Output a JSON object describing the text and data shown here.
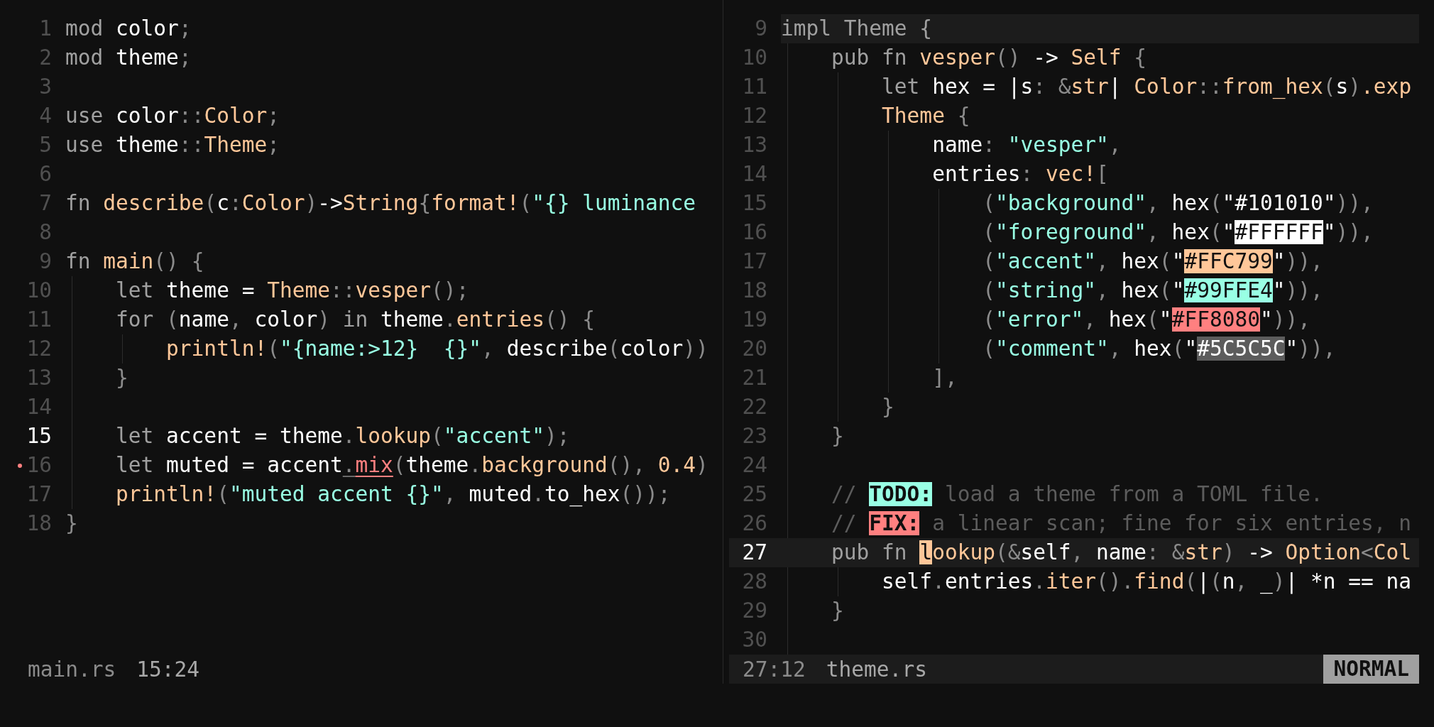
{
  "panes": [
    {
      "active": false,
      "lines": [
        {
          "number": "1",
          "current": false,
          "tokens": [
            {
              "text": "mod",
              "kind": "keyword"
            },
            {
              "text": " color",
              "kind": "ident"
            },
            {
              "text": ";",
              "kind": "punct"
            }
          ]
        },
        {
          "number": "2",
          "current": false,
          "tokens": [
            {
              "text": "mod",
              "kind": "keyword"
            },
            {
              "text": " theme",
              "kind": "ident"
            },
            {
              "text": ";",
              "kind": "punct"
            }
          ]
        },
        {
          "number": "3",
          "current": false
        },
        {
          "number": "4",
          "current": false,
          "tokens": [
            {
              "text": "use",
              "kind": "keyword"
            },
            {
              "text": " color",
              "kind": "ident"
            },
            {
              "text": "::",
              "kind": "punct"
            },
            {
              "text": "Color",
              "kind": "func"
            },
            {
              "text": ";",
              "kind": "punct"
            }
          ]
        },
        {
          "number": "5",
          "current": false,
          "tokens": [
            {
              "text": "use",
              "kind": "keyword"
            },
            {
              "text": " theme",
              "kind": "ident"
            },
            {
              "text": "::",
              "kind": "punct"
            },
            {
              "text": "Theme",
              "kind": "func"
            },
            {
              "text": ";",
              "kind": "punct"
            }
          ]
        },
        {
          "number": "6",
          "current": false
        },
        {
          "number": "7",
          "current": false,
          "tokens": [
            {
              "text": "fn",
              "kind": "keyword"
            },
            {
              "text": " describe",
              "kind": "func"
            },
            {
              "text": "(",
              "kind": "punct"
            },
            {
              "text": "c",
              "kind": "ident"
            },
            {
              "text": ":",
              "kind": "punct"
            },
            {
              "text": "Color",
              "kind": "func"
            },
            {
              "text": ")",
              "kind": "punct"
            },
            {
              "text": "->",
              "kind": "ident"
            },
            {
              "text": "String",
              "kind": "func"
            },
            {
              "text": "{",
              "kind": "punct"
            },
            {
              "text": "format!",
              "kind": "func"
            },
            {
              "text": "(",
              "kind": "punct"
            },
            {
              "text": "\"{} luminance",
              "kind": "string"
            }
          ]
        },
        {
          "number": "8",
          "current": false
        },
        {
          "number": "9",
          "current": false,
          "tokens": [
            {
              "text": "fn",
              "kind": "keyword"
            },
            {
              "text": " main",
              "kind": "func"
            },
            {
              "text": "() {",
              "kind": "punct"
            }
          ]
        },
        {
          "number": "10",
          "current": false,
          "tokens": [
            {
              "text": "    let",
              "kind": "keyword"
            },
            {
              "text": " theme = ",
              "kind": "ident"
            },
            {
              "text": "Theme",
              "kind": "func"
            },
            {
              "text": "::",
              "kind": "punct"
            },
            {
              "text": "vesper",
              "kind": "func"
            },
            {
              "text": "();",
              "kind": "punct"
            }
          ]
        },
        {
          "number": "11",
          "current": false,
          "tokens": [
            {
              "text": "    for",
              "kind": "keyword"
            },
            {
              "text": " (",
              "kind": "punct"
            },
            {
              "text": "name",
              "kind": "ident"
            },
            {
              "text": ", ",
              "kind": "punct"
            },
            {
              "text": "color",
              "kind": "ident"
            },
            {
              "text": ")",
              "kind": "punct"
            },
            {
              "text": " in",
              "kind": "keyword"
            },
            {
              "text": " theme",
              "kind": "ident"
            },
            {
              "text": ".",
              "kind": "punct"
            },
            {
              "text": "entries",
              "kind": "func"
            },
            {
              "text": "() {",
              "kind": "punct"
            }
          ]
        },
        {
          "number": "12",
          "current": false,
          "tokens": [
            {
              "text": "        println!",
              "kind": "func"
            },
            {
              "text": "(",
              "kind": "punct"
            },
            {
              "text": "\"{name:>12}  {}\"",
              "kind": "string"
            },
            {
              "text": ", ",
              "kind": "punct"
            },
            {
              "text": "describe",
              "kind": "ident"
            },
            {
              "text": "(",
              "kind": "punct"
            },
            {
              "text": "color",
              "kind": "ident"
            },
            {
              "text": "))",
              "kind": "punct"
            }
          ]
        },
        {
          "number": "13",
          "current": false,
          "tokens": [
            {
              "text": "    }",
              "kind": "punct"
            }
          ]
        },
        {
          "number": "14",
          "current": false
        },
        {
          "number": "15",
          "current": true,
          "tokens": [
            {
              "text": "    let",
              "kind": "keyword"
            },
            {
              "text": " accent = theme",
              "kind": "ident"
            },
            {
              "text": ".",
              "kind": "punct"
            },
            {
              "text": "lookup",
              "kind": "func"
            },
            {
              "text": "(",
              "kind": "punct"
            },
            {
              "text": "\"accent\"",
              "kind": "string"
            },
            {
              "text": ");",
              "kind": "punct"
            }
          ]
        },
        {
          "number": "16",
          "current": false,
          "has_error": true,
          "tokens": [
            {
              "text": "    let",
              "kind": "keyword"
            },
            {
              "text": " muted = accent",
              "kind": "ident"
            },
            {
              "text": ".",
              "kind": "punct",
              "underlined": true
            },
            {
              "text": "mix",
              "kind": "func",
              "error": true
            },
            {
              "text": "(",
              "kind": "punct"
            },
            {
              "text": "theme",
              "kind": "ident"
            },
            {
              "text": ".",
              "kind": "punct"
            },
            {
              "text": "background",
              "kind": "func"
            },
            {
              "text": "(), ",
              "kind": "punct"
            },
            {
              "text": "0.4",
              "kind": "func"
            },
            {
              "text": ")",
              "kind": "punct"
            }
          ]
        },
        {
          "number": "17",
          "current": false,
          "tokens": [
            {
              "text": "    println!",
              "kind": "func"
            },
            {
              "text": "(",
              "kind": "punct"
            },
            {
              "text": "\"muted accent {}\"",
              "kind": "string"
            },
            {
              "text": ", ",
              "kind": "punct"
            },
            {
              "text": "muted",
              "kind": "ident"
            },
            {
              "text": ".",
              "kind": "punct"
            },
            {
              "text": "to_hex",
              "kind": "ident"
            },
            {
              "text": "());",
              "kind": "punct"
            }
          ]
        },
        {
          "number": "18",
          "current": false,
          "tokens": [
            {
              "text": "}",
              "kind": "punct"
            }
          ]
        }
      ],
      "status_bar": {
        "items": [
          "main.rs",
          "15:24"
        ]
      }
    },
    {
      "active": true,
      "lines": [
        {
          "number": "9",
          "current": false,
          "sticky": true,
          "tokens": [
            {
              "text": "impl",
              "kind": "keyword"
            },
            {
              "text": " Theme {",
              "kind": "keyword"
            }
          ]
        },
        {
          "number": "10",
          "current": false,
          "tokens": [
            {
              "text": "    pub fn",
              "kind": "keyword"
            },
            {
              "text": " vesper",
              "kind": "func"
            },
            {
              "text": "()",
              "kind": "punct"
            },
            {
              "text": " ->",
              "kind": "ident"
            },
            {
              "text": " Self",
              "kind": "func"
            },
            {
              "text": " {",
              "kind": "punct"
            }
          ]
        },
        {
          "number": "11",
          "current": false,
          "tokens": [
            {
              "text": "        let",
              "kind": "keyword"
            },
            {
              "text": " hex = |s",
              "kind": "ident"
            },
            {
              "text": ": &",
              "kind": "punct"
            },
            {
              "text": "str",
              "kind": "func"
            },
            {
              "text": "|",
              "kind": "ident"
            },
            {
              "text": " Color",
              "kind": "func"
            },
            {
              "text": "::",
              "kind": "punct"
            },
            {
              "text": "from_hex",
              "kind": "func"
            },
            {
              "text": "(",
              "kind": "punct"
            },
            {
              "text": "s",
              "kind": "ident"
            },
            {
              "text": ")",
              "kind": "punct"
            },
            {
              "text": ".exp",
              "kind": "func"
            }
          ]
        },
        {
          "number": "12",
          "current": false,
          "tokens": [
            {
              "text": "        Theme",
              "kind": "func"
            },
            {
              "text": " {",
              "kind": "punct"
            }
          ]
        },
        {
          "number": "13",
          "current": false,
          "tokens": [
            {
              "text": "            name",
              "kind": "ident"
            },
            {
              "text": ": ",
              "kind": "punct"
            },
            {
              "text": "\"vesper\"",
              "kind": "string"
            },
            {
              "text": ",",
              "kind": "punct"
            }
          ]
        },
        {
          "number": "14",
          "current": false,
          "tokens": [
            {
              "text": "            entries",
              "kind": "ident"
            },
            {
              "text": ": ",
              "kind": "punct"
            },
            {
              "text": "vec!",
              "kind": "func"
            },
            {
              "text": "[",
              "kind": "punct"
            }
          ]
        },
        {
          "number": "15",
          "current": false,
          "tokens": [
            {
              "text": "                (",
              "kind": "punct"
            },
            {
              "text": "\"background\"",
              "kind": "string"
            },
            {
              "text": ", ",
              "kind": "punct"
            },
            {
              "text": "hex",
              "kind": "ident"
            },
            {
              "text": "(",
              "kind": "punct"
            },
            {
              "text": "\"",
              "kind": "ident"
            },
            {
              "text": "#101010",
              "kind": "swatch",
              "color": "#101010"
            },
            {
              "text": "\"",
              "kind": "ident"
            },
            {
              "text": ")),",
              "kind": "punct"
            }
          ]
        },
        {
          "number": "16",
          "current": false,
          "tokens": [
            {
              "text": "                (",
              "kind": "punct"
            },
            {
              "text": "\"foreground\"",
              "kind": "string"
            },
            {
              "text": ", ",
              "kind": "punct"
            },
            {
              "text": "hex",
              "kind": "ident"
            },
            {
              "text": "(",
              "kind": "punct"
            },
            {
              "text": "\"",
              "kind": "ident"
            },
            {
              "text": "#FFFFFF",
              "kind": "swatch",
              "color": "#ffffff"
            },
            {
              "text": "\"",
              "kind": "ident"
            },
            {
              "text": ")),",
              "kind": "punct"
            }
          ]
        },
        {
          "number": "17",
          "current": false,
          "tokens": [
            {
              "text": "                (",
              "kind": "punct"
            },
            {
              "text": "\"accent\"",
              "kind": "string"
            },
            {
              "text": ", ",
              "kind": "punct"
            },
            {
              "text": "hex",
              "kind": "ident"
            },
            {
              "text": "(",
              "kind": "punct"
            },
            {
              "text": "\"",
              "kind": "ident"
            },
            {
              "text": "#FFC799",
              "kind": "swatch",
              "color": "#ffc799"
            },
            {
              "text": "\"",
              "kind": "ident"
            },
            {
              "text": ")),",
              "kind": "punct"
            }
          ]
        },
        {
          "number": "18",
          "current": false,
          "tokens": [
            {
              "text": "                (",
              "kind": "punct"
            },
            {
              "text": "\"string\"",
              "kind": "string"
            },
            {
              "text": ", ",
              "kind": "punct"
            },
            {
              "text": "hex",
              "kind": "ident"
            },
            {
              "text": "(",
              "kind": "punct"
            },
            {
              "text": "\"",
              "kind": "ident"
            },
            {
              "text": "#99FFE4",
              "kind": "swatch",
              "color": "#99ffe4"
            },
            {
              "text": "\"",
              "kind": "ident"
            },
            {
              "text": ")),",
              "kind": "punct"
            }
          ]
        },
        {
          "number": "19",
          "current": false,
          "tokens": [
            {
              "text": "                (",
              "kind": "punct"
            },
            {
              "text": "\"error\"",
              "kind": "string"
            },
            {
              "text": ", ",
              "kind": "punct"
            },
            {
              "text": "hex",
              "kind": "ident"
            },
            {
              "text": "(",
              "kind": "punct"
            },
            {
              "text": "\"",
              "kind": "ident"
            },
            {
              "text": "#FF8080",
              "kind": "swatch",
              "color": "#ff8080"
            },
            {
              "text": "\"",
              "kind": "ident"
            },
            {
              "text": ")),",
              "kind": "punct"
            }
          ]
        },
        {
          "number": "20",
          "current": false,
          "tokens": [
            {
              "text": "                (",
              "kind": "punct"
            },
            {
              "text": "\"comment\"",
              "kind": "string"
            },
            {
              "text": ", ",
              "kind": "punct"
            },
            {
              "text": "hex",
              "kind": "ident"
            },
            {
              "text": "(",
              "kind": "punct"
            },
            {
              "text": "\"",
              "kind": "ident"
            },
            {
              "text": "#5C5C5C",
              "kind": "swatch",
              "color": "#5c5c5c"
            },
            {
              "text": "\"",
              "kind": "ident"
            },
            {
              "text": ")),",
              "kind": "punct"
            }
          ]
        },
        {
          "number": "21",
          "current": false,
          "tokens": [
            {
              "text": "            ],",
              "kind": "punct"
            }
          ]
        },
        {
          "number": "22",
          "current": false,
          "tokens": [
            {
              "text": "        }",
              "kind": "punct"
            }
          ]
        },
        {
          "number": "23",
          "current": false,
          "tokens": [
            {
              "text": "    }",
              "kind": "punct"
            }
          ]
        },
        {
          "number": "24",
          "current": false
        },
        {
          "number": "25",
          "current": false,
          "tokens": [
            {
              "text": "    // ",
              "kind": "comment"
            },
            {
              "text": "TODO:",
              "kind": "tag",
              "color": "#99ffe4"
            },
            {
              "text": " load a theme from a TOML file.",
              "kind": "comment"
            }
          ]
        },
        {
          "number": "26",
          "current": false,
          "tokens": [
            {
              "text": "    // ",
              "kind": "comment"
            },
            {
              "text": "FIX:",
              "kind": "tag",
              "color": "#ff8080"
            },
            {
              "text": " a linear scan; fine for six entries, n",
              "kind": "comment"
            }
          ]
        },
        {
          "number": "27",
          "current": true,
          "tokens": [
            {
              "text": "    pub fn ",
              "kind": "keyword"
            },
            {
              "text": "l",
              "kind": "func",
              "cursor": true
            },
            {
              "text": "ookup",
              "kind": "func"
            },
            {
              "text": "(&",
              "kind": "punct"
            },
            {
              "text": "self",
              "kind": "ident"
            },
            {
              "text": ", ",
              "kind": "punct"
            },
            {
              "text": "name",
              "kind": "ident"
            },
            {
              "text": ": &",
              "kind": "punct"
            },
            {
              "text": "str",
              "kind": "func"
            },
            {
              "text": ")",
              "kind": "punct"
            },
            {
              "text": " ->",
              "kind": "ident"
            },
            {
              "text": " Option",
              "kind": "func"
            },
            {
              "text": "<",
              "kind": "punct"
            },
            {
              "text": "Col",
              "kind": "func"
            }
          ]
        },
        {
          "number": "28",
          "current": false,
          "tokens": [
            {
              "text": "        self",
              "kind": "ident"
            },
            {
              "text": ".",
              "kind": "punct"
            },
            {
              "text": "entries",
              "kind": "ident"
            },
            {
              "text": ".",
              "kind": "punct"
            },
            {
              "text": "iter",
              "kind": "func"
            },
            {
              "text": "().",
              "kind": "punct"
            },
            {
              "text": "find",
              "kind": "func"
            },
            {
              "text": "(",
              "kind": "punct"
            },
            {
              "text": "|",
              "kind": "ident"
            },
            {
              "text": "(",
              "kind": "punct"
            },
            {
              "text": "n",
              "kind": "ident"
            },
            {
              "text": ", ",
              "kind": "punct"
            },
            {
              "text": "_",
              "kind": "ident"
            },
            {
              "text": ")",
              "kind": "punct"
            },
            {
              "text": "| *n == na",
              "kind": "ident"
            }
          ]
        },
        {
          "number": "29",
          "current": false,
          "tokens": [
            {
              "text": "    }",
              "kind": "punct"
            }
          ]
        },
        {
          "number": "30",
          "current": false
        }
      ],
      "status_bar": {
        "items": [
          "27:12",
          "theme.rs"
        ],
        "mode": "NORMAL"
      }
    }
  ]
}
